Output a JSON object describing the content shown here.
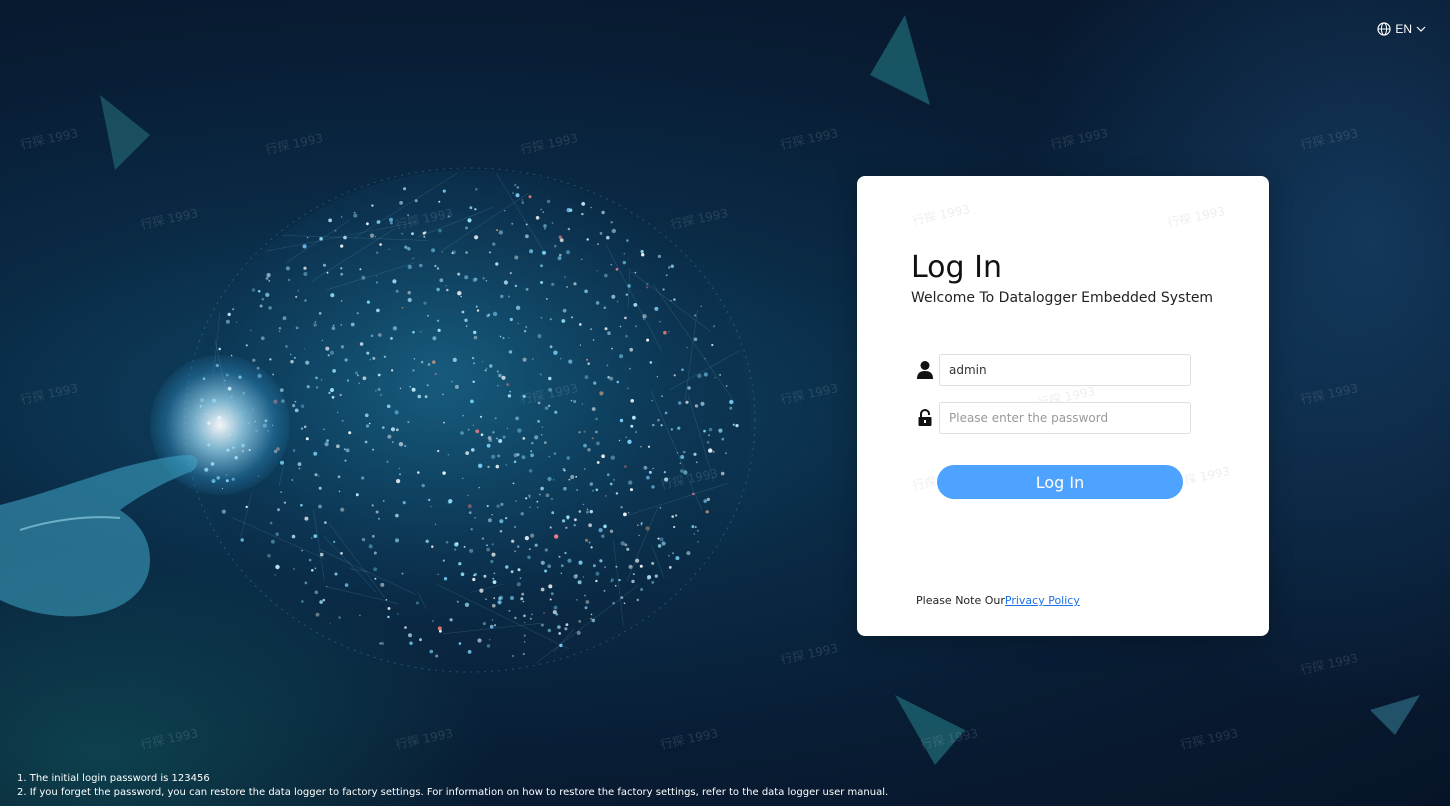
{
  "header": {
    "language_label": "EN",
    "language_icon": "globe-icon",
    "dropdown_icon": "chevron-down-icon"
  },
  "background": {
    "watermark_text": "行探 1993"
  },
  "login": {
    "title": "Log In",
    "subtitle": "Welcome To Datalogger Embedded System",
    "username_value": "admin",
    "username_icon": "user-icon",
    "password_value": "",
    "password_placeholder": "Please enter the password",
    "password_icon": "lock-icon",
    "submit_label": "Log In",
    "privacy_prefix": "Please Note Our",
    "privacy_link": "Privacy Policy",
    "button_color": "#4da3ff"
  },
  "footer": {
    "notes": [
      "1. The initial login password is 123456",
      "2. If you forget the password, you can restore the data logger to factory settings. For information on how to restore the factory settings, refer to the data logger user manual."
    ]
  }
}
